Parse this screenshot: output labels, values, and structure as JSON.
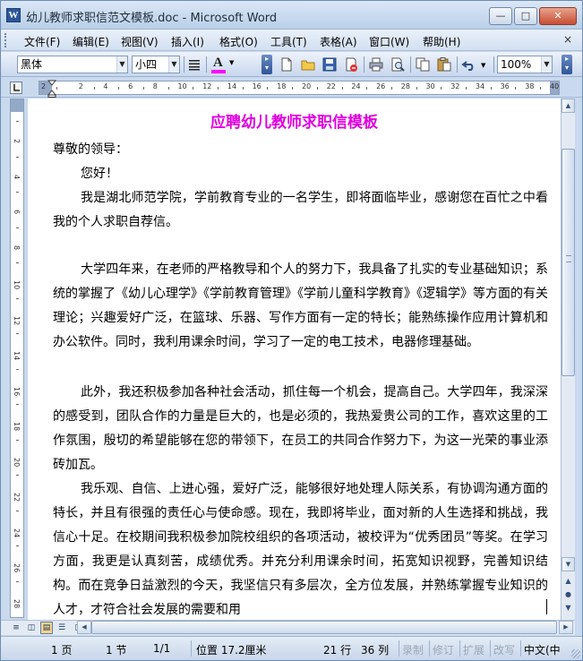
{
  "window": {
    "title": "幼儿教师求职信范文模板.doc - Microsoft Word",
    "app_icon_letter": "W",
    "min_glyph": "—",
    "max_glyph": "□",
    "close_glyph": "✕"
  },
  "menu": {
    "items": [
      "文件(F)",
      "编辑(E)",
      "视图(V)",
      "插入(I)",
      "格式(O)",
      "工具(T)",
      "表格(A)",
      "窗口(W)",
      "帮助(H)"
    ],
    "close_glyph": "×"
  },
  "toolbar": {
    "font_name": "黑体",
    "font_size": "小四",
    "zoom": "100%",
    "font_color_letter": "A",
    "colors": {
      "font_color_bar": "#ff00ff"
    }
  },
  "ruler": {
    "h_numbers": [
      "2",
      "2",
      "4",
      "6",
      "8",
      "10",
      "12",
      "14",
      "16",
      "18",
      "20",
      "22",
      "24",
      "26",
      "28",
      "30",
      "32",
      "34",
      "36",
      "38",
      "40"
    ],
    "v_numbers": [
      "2",
      "4",
      "6",
      "8",
      "10",
      "12",
      "14",
      "16",
      "18",
      "20",
      "22",
      "24",
      "26",
      "28"
    ]
  },
  "document": {
    "title": "应聘幼儿教师求职信模板",
    "title_color": "#e000e0",
    "salutation": "尊敬的领导：",
    "greeting": "您好！",
    "paragraphs": [
      "我是湖北师范学院，学前教育专业的一名学生，即将面临毕业，感谢您在百忙之中看我的个人求职自荐信。",
      "大学四年来，在老师的严格教导和个人的努力下，我具备了扎实的专业基础知识；系统的掌握了《幼儿心理学》《学前教育管理》《学前儿童科学教育》《逻辑学》等方面的有关理论；兴趣爱好广泛，在篮球、乐器、写作方面有一定的特长；能熟练操作应用计算机和办公软件。同时，我利用课余时间，学习了一定的电工技术，电器修理基础。",
      "此外，我还积极参加各种社会活动，抓住每一个机会，提高自己。大学四年，我深深的感受到，团队合作的力量是巨大的，也是必须的，我热爱贵公司的工作，喜欢这里的工作氛围，殷切的希望能够在您的带领下，在员工的共同合作努力下，为这一光荣的事业添砖加瓦。",
      "我乐观、自信、上进心强，爱好广泛，能够很好地处理人际关系，有协调沟通方面的特长，并且有很强的责任心与使命感。现在，我即将毕业，面对新的人生选择和挑战，我信心十足。在校期间我积极参加院校组织的各项活动，被校评为“优秀团员”等奖。在学习方面，我更是认真刻苦，成绩优秀。并充分利用课余时间，拓宽知识视野，完善知识结构。而在竞争日益激烈的今天，我坚信只有多层次，全方位发展，并熟练掌握专业知识的人才，才符合社会发展的需要和用"
    ]
  },
  "statusbar": {
    "page": "1 页",
    "section": "1 节",
    "page_of": "1/1",
    "position": "位置 17.2厘米",
    "line": "21 行",
    "column": "36 列",
    "rec": "录制",
    "trk": "修订",
    "ext": "扩展",
    "ovr": "改写",
    "language": "中文(中"
  }
}
